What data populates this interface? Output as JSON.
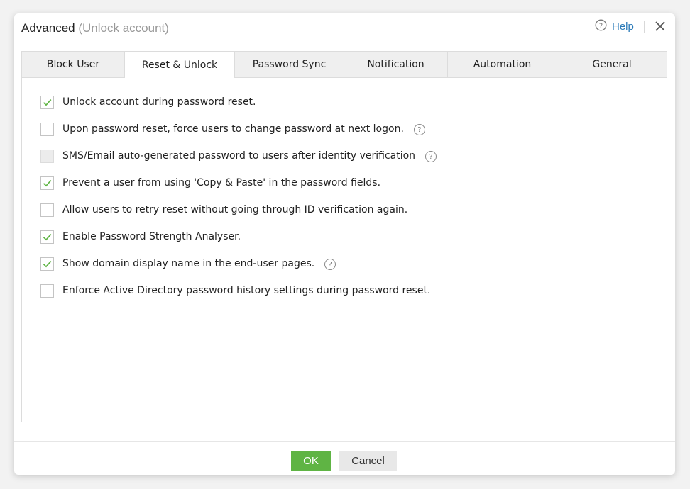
{
  "dialog": {
    "title": "Advanced",
    "subtitle": "(Unlock account)",
    "help_label": "Help",
    "help_icon": "help-circle-icon",
    "close_icon": "close-icon"
  },
  "tabs": [
    {
      "label": "Block User",
      "active": false
    },
    {
      "label": "Reset & Unlock",
      "active": true
    },
    {
      "label": "Password Sync",
      "active": false
    },
    {
      "label": "Notification",
      "active": false
    },
    {
      "label": "Automation",
      "active": false
    },
    {
      "label": "General",
      "active": false
    }
  ],
  "options": [
    {
      "label": "Unlock account during password reset.",
      "checked": true,
      "disabled": false,
      "help": false
    },
    {
      "label": "Upon password reset, force users to change password at next logon.",
      "checked": false,
      "disabled": false,
      "help": true
    },
    {
      "label": "SMS/Email auto-generated password to users after identity verification",
      "checked": false,
      "disabled": true,
      "help": true
    },
    {
      "label": "Prevent a user from using 'Copy & Paste' in the password fields.",
      "checked": true,
      "disabled": false,
      "help": false
    },
    {
      "label": "Allow users to retry reset without going through ID verification again.",
      "checked": false,
      "disabled": false,
      "help": false
    },
    {
      "label": "Enable Password Strength Analyser.",
      "checked": true,
      "disabled": false,
      "help": false
    },
    {
      "label": "Show domain display name in the end-user pages.",
      "checked": true,
      "disabled": false,
      "help": true
    },
    {
      "label": "Enforce Active Directory password history settings during password reset.",
      "checked": false,
      "disabled": false,
      "help": false
    }
  ],
  "help_glyph": "?",
  "footer": {
    "ok_label": "OK",
    "cancel_label": "Cancel"
  },
  "colors": {
    "ok_button": "#5fb444",
    "check_mark": "#5fb444",
    "help_link": "#2a7ab8"
  }
}
